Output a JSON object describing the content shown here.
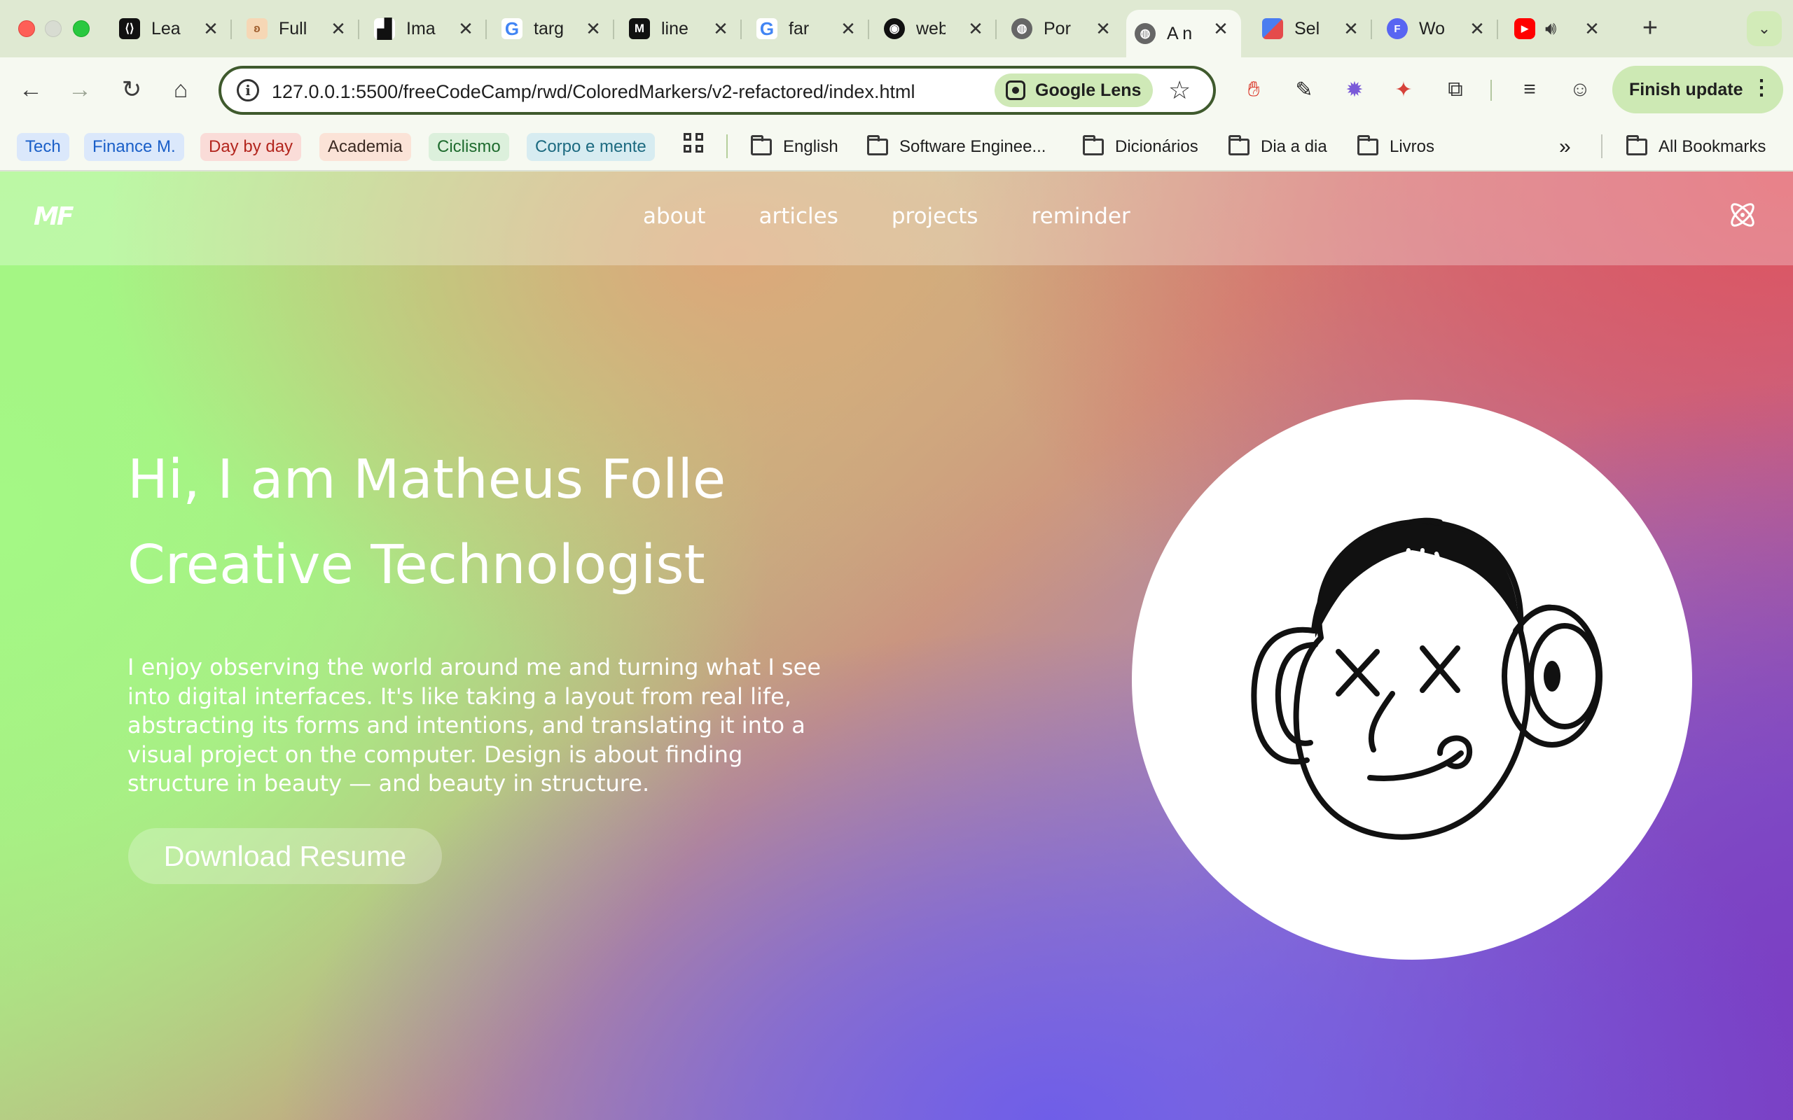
{
  "browser": {
    "tabs": [
      {
        "title": "Learn",
        "favicon": "brackets-logo-icon",
        "color": "#111111"
      },
      {
        "title": "Full",
        "favicon": "hamster-icon",
        "color": "#f3c49a"
      },
      {
        "title": "Image",
        "favicon": "unsplash-icon",
        "color": "#111111"
      },
      {
        "title": "target",
        "favicon": "google-icon",
        "color": "#4285f4"
      },
      {
        "title": "line",
        "favicon": "medium-icon",
        "color": "#111111"
      },
      {
        "title": "far",
        "favicon": "google-icon",
        "color": "#4285f4"
      },
      {
        "title": "web",
        "favicon": "github-icon",
        "color": "#111111"
      },
      {
        "title": "Por",
        "favicon": "globe-icon",
        "color": "#555555"
      },
      {
        "title": "A n",
        "favicon": "globe-icon",
        "color": "#555555",
        "active": true
      },
      {
        "title": "Sel",
        "favicon": "colorful-icon",
        "color": "#e54b4b"
      },
      {
        "title": "Wo",
        "favicon": "f-circle-icon",
        "color": "#5865f2"
      },
      {
        "title": "",
        "favicon": "youtube-icon",
        "color": "#ff0000",
        "audio": true
      }
    ],
    "new_tab_symbol": "+",
    "omnibox": {
      "url": "127.0.0.1:5500/freeCodeCamp/rwd/ColoredMarkers/v2-refactored/index.html",
      "lens_label": "Google Lens"
    },
    "finish_update_label": "Finish update",
    "bookmarks": {
      "chips": [
        {
          "label": "Tech",
          "bg": "#dbe8fb",
          "fg": "#1a5fc8"
        },
        {
          "label": "Finance M.",
          "bg": "#dbe8fb",
          "fg": "#1a5fc8"
        },
        {
          "label": "Day by day",
          "bg": "#fadcd8",
          "fg": "#b3261e"
        },
        {
          "label": "Academia",
          "bg": "#fbe3d7",
          "fg": "#3b2a22"
        },
        {
          "label": "Ciclismo",
          "bg": "#dcf0dc",
          "fg": "#1e6b2e"
        },
        {
          "label": "Corpo e mente",
          "bg": "#d7ecf1",
          "fg": "#1c6a80"
        }
      ],
      "folders": [
        "English",
        "Software Enginee...",
        "Dicionários",
        "Dia a dia",
        "Livros"
      ],
      "overflow": "»",
      "all_bookmarks": "All Bookmarks"
    }
  },
  "page": {
    "logo": "MF",
    "nav": [
      "about",
      "articles",
      "projects",
      "reminder"
    ],
    "hero": {
      "line1": "Hi, I am Matheus Folle",
      "line2": "Creative Technologist",
      "description": "I enjoy observing the world around me and turning what I see into digital interfaces. It's like taking a layout from real life, abstracting its forms and intentions, and translating it into a visual project on the computer. Design is about finding structure in beauty — and beauty in structure.",
      "button": "Download Resume"
    },
    "colors": {
      "gradient_green": "#a4f885",
      "gradient_red": "#e0525c",
      "gradient_purple": "#7a46c2",
      "gradient_blue": "#6f5ee8"
    }
  }
}
